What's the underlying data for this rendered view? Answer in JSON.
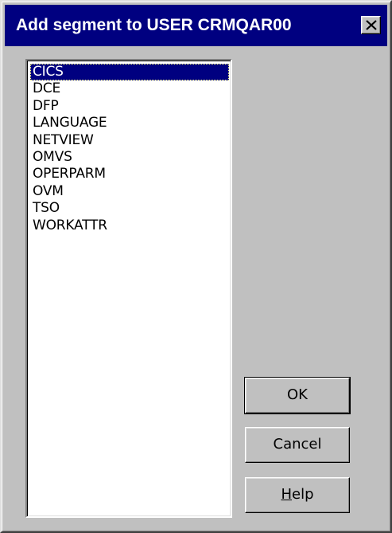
{
  "window": {
    "title": "Add segment to USER CRMQAR00",
    "close_icon": "close-icon"
  },
  "segment_list": {
    "selected_index": 0,
    "items": [
      "CICS",
      "DCE",
      "DFP",
      "LANGUAGE",
      "NETVIEW",
      "OMVS",
      "OPERPARM",
      "OVM",
      "TSO",
      "WORKATTR"
    ]
  },
  "buttons": {
    "ok_label": "OK",
    "cancel_label": "Cancel",
    "help_mnemonic": "H",
    "help_rest": "elp"
  },
  "colors": {
    "titlebar": "#000080",
    "face": "#c0c0c0",
    "selection": "#000080"
  }
}
